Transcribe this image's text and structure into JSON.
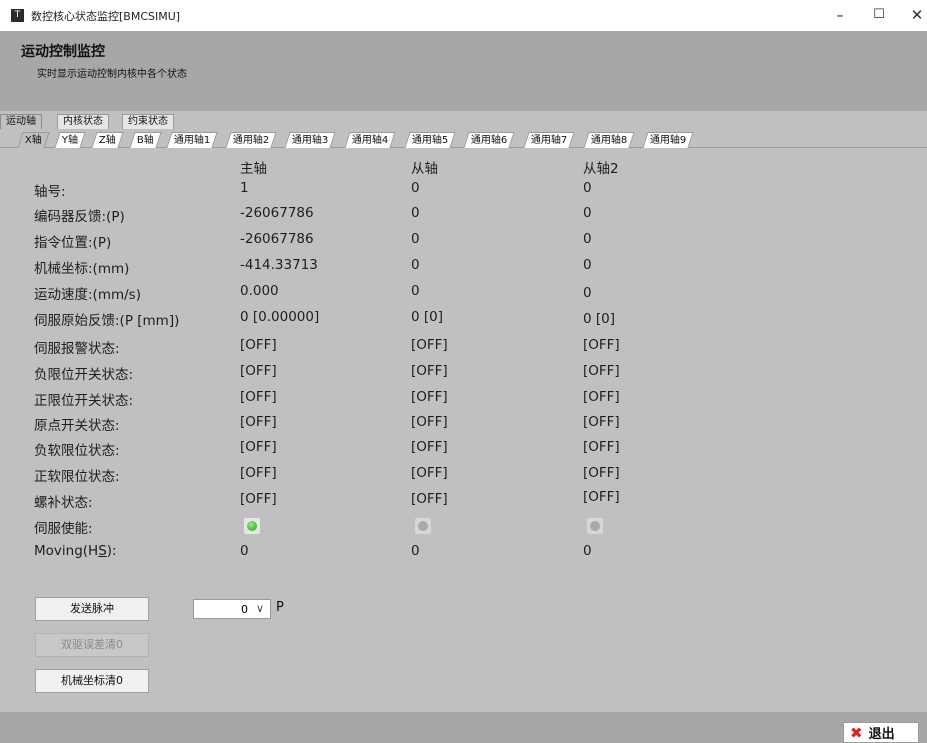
{
  "window": {
    "title": "数控核心状态监控[BMCSIMU]",
    "app_icon_glyph": "T",
    "minimize_glyph": "–",
    "maximize_glyph": "☐",
    "close_glyph": "✕"
  },
  "header": {
    "title": "运动控制监控",
    "subtitle": "实时显示运动控制内核中各个状态"
  },
  "tabs_main": [
    "运动轴",
    "内核状态",
    "约束状态"
  ],
  "tabs_axis": [
    "X轴",
    "Y轴",
    "Z轴",
    "B轴",
    "通用轴1",
    "通用轴2",
    "通用轴3",
    "通用轴4",
    "通用轴5",
    "通用轴6",
    "通用轴7",
    "通用轴8",
    "通用轴9"
  ],
  "table": {
    "columns": [
      "主轴",
      "从轴",
      "从轴2"
    ],
    "rows": [
      {
        "label": "轴号:",
        "values": [
          "1",
          "0",
          "0"
        ]
      },
      {
        "label": "编码器反馈:(P)",
        "values": [
          "-26067786",
          "0",
          "0"
        ]
      },
      {
        "label": "指令位置:(P)",
        "values": [
          "-26067786",
          "0",
          "0"
        ]
      },
      {
        "label": "机械坐标:(mm)",
        "values": [
          "-414.33713",
          "0",
          "0"
        ]
      },
      {
        "label": "运动速度:(mm/s)",
        "values": [
          "0.000",
          "0",
          "0"
        ]
      },
      {
        "label": "伺服原始反馈:(P [mm])",
        "values": [
          "0 [0.00000]",
          "0 [0]",
          "0 [0]"
        ]
      },
      {
        "label": "伺服报警状态:",
        "values": [
          "[OFF]",
          "[OFF]",
          "[OFF]"
        ]
      },
      {
        "label": "负限位开关状态:",
        "values": [
          "[OFF]",
          "[OFF]",
          "[OFF]"
        ]
      },
      {
        "label": "正限位开关状态:",
        "values": [
          "[OFF]",
          "[OFF]",
          "[OFF]"
        ]
      },
      {
        "label": "原点开关状态:",
        "values": [
          "[OFF]",
          "[OFF]",
          "[OFF]"
        ]
      },
      {
        "label": "负软限位状态:",
        "values": [
          "[OFF]",
          "[OFF]",
          "[OFF]"
        ]
      },
      {
        "label": "正软限位状态:",
        "values": [
          "[OFF]",
          "[OFF]",
          "[OFF]"
        ]
      },
      {
        "label": "螺补状态:",
        "values": [
          "[OFF]",
          "[OFF]",
          "[OFF]"
        ]
      }
    ],
    "servo_enable_label": "伺服使能:",
    "servo_enable": [
      true,
      false,
      false
    ],
    "moving_label": "Moving(HS):",
    "moving_values": [
      "0",
      "0",
      "0"
    ]
  },
  "controls": {
    "send_pulse": "发送脉冲",
    "pulse_value": "0",
    "pulse_unit": "P",
    "clear_dual_error": "双驱误差清0",
    "clear_machine_coord": "机械坐标清0"
  },
  "footer": {
    "exit_label": "退出",
    "exit_icon": "✖"
  },
  "colors": {
    "led_on": "#1f9f1f",
    "exit_icon": "#dd2222"
  }
}
